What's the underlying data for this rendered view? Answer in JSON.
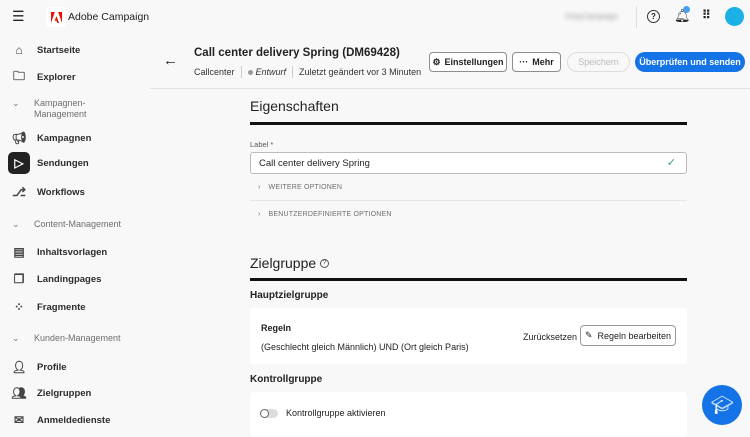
{
  "app": {
    "name": "Adobe Campaign",
    "org": "OnlyCampaign"
  },
  "sidebar": {
    "items": [
      {
        "label": "Startseite"
      },
      {
        "label": "Explorer"
      },
      {
        "label": "Kampagnen"
      },
      {
        "label": "Sendungen"
      },
      {
        "label": "Workflows"
      },
      {
        "label": "Inhaltsvorlagen"
      },
      {
        "label": "Landingpages"
      },
      {
        "label": "Fragmente"
      },
      {
        "label": "Profile"
      },
      {
        "label": "Zielgruppen"
      },
      {
        "label": "Anmeldedienste"
      }
    ],
    "groups": [
      {
        "label": "Kampagnen-Management"
      },
      {
        "label": "Content-Management"
      },
      {
        "label": "Kunden-Management"
      }
    ]
  },
  "header": {
    "title": "Call center delivery Spring (DM69428)",
    "channel": "Callcenter",
    "status": "Entwurf",
    "modified": "Zuletzt geändert vor 3 Minuten",
    "settings_label": "Einstellungen",
    "more_label": "Mehr",
    "save_label": "Speichern",
    "review_label": "Überprüfen und senden"
  },
  "properties": {
    "title": "Eigenschaften",
    "label_field": "Label *",
    "label_value": "Call center delivery Spring",
    "more_options": "WEITERE OPTIONEN",
    "custom_options": "BENUTZERDEFINIERTE OPTIONEN"
  },
  "audience": {
    "title": "Zielgruppe",
    "main_title": "Hauptzielgruppe",
    "rules_title": "Regeln",
    "rules_value": "(Geschlecht gleich Männlich) UND (Ort gleich Paris)",
    "reset_label": "Zurücksetzen",
    "edit_label": "Regeln bearbeiten",
    "control_title": "Kontrollgruppe",
    "control_toggle_label": "Kontrollgruppe aktivieren",
    "control_enabled": false
  },
  "colors": {
    "accent": "#1473e6",
    "adobe_red": "#eb1000",
    "check": "#2d9d78"
  }
}
